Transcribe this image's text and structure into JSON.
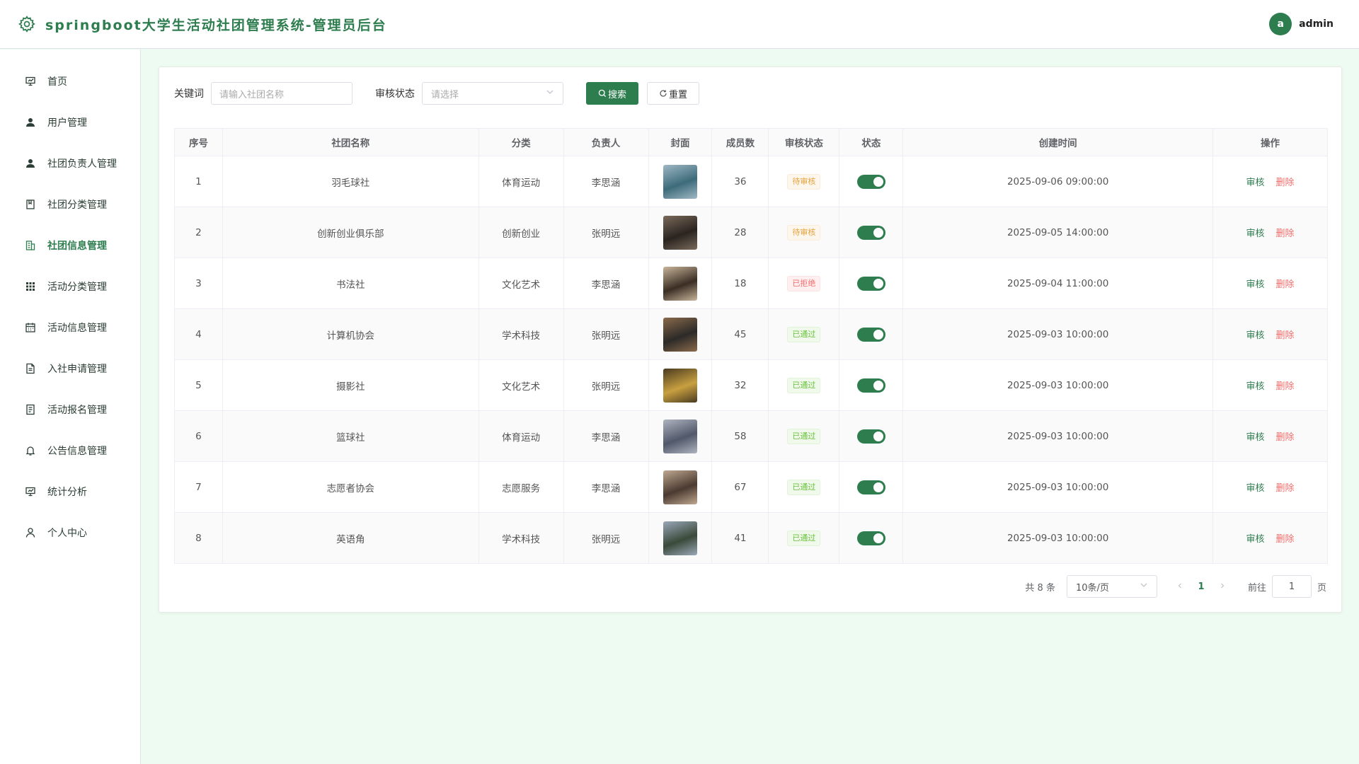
{
  "app": {
    "title": "springboot大学生活动社团管理系统-管理员后台"
  },
  "user": {
    "avatar_letter": "a",
    "name": "admin"
  },
  "colors": {
    "primary": "#2e7d4f",
    "danger": "#f56c6c",
    "warning": "#e6a23c",
    "success": "#67c23a"
  },
  "sidebar": {
    "items": [
      {
        "label": "首页",
        "icon": "presentation-icon",
        "active": false
      },
      {
        "label": "用户管理",
        "icon": "user-icon",
        "active": false
      },
      {
        "label": "社团负责人管理",
        "icon": "user-icon",
        "active": false
      },
      {
        "label": "社团分类管理",
        "icon": "bookmark-icon",
        "active": false
      },
      {
        "label": "社团信息管理",
        "icon": "building-icon",
        "active": true
      },
      {
        "label": "活动分类管理",
        "icon": "grid-icon",
        "active": false
      },
      {
        "label": "活动信息管理",
        "icon": "calendar-icon",
        "active": false
      },
      {
        "label": "入社申请管理",
        "icon": "document-icon",
        "active": false
      },
      {
        "label": "活动报名管理",
        "icon": "list-icon",
        "active": false
      },
      {
        "label": "公告信息管理",
        "icon": "bell-icon",
        "active": false
      },
      {
        "label": "统计分析",
        "icon": "chart-icon",
        "active": false
      },
      {
        "label": "个人中心",
        "icon": "person-icon",
        "active": false
      }
    ]
  },
  "filters": {
    "keyword_label": "关键词",
    "keyword_placeholder": "请输入社团名称",
    "status_label": "审核状态",
    "status_placeholder": "请选择",
    "search_label": "搜索",
    "reset_label": "重置"
  },
  "table": {
    "headers": [
      "序号",
      "社团名称",
      "分类",
      "负责人",
      "封面",
      "成员数",
      "审核状态",
      "状态",
      "创建时间",
      "操作"
    ],
    "audit_label": "审核",
    "delete_label": "删除",
    "rows": [
      {
        "idx": "1",
        "name": "羽毛球社",
        "category": "体育运动",
        "leader": "李思涵",
        "members": "36",
        "audit": "待审核",
        "audit_type": "pending",
        "enabled": true,
        "created": "2025-09-06 09:00:00",
        "cover": [
          "#3d6b7a",
          "#9fb8c4"
        ]
      },
      {
        "idx": "2",
        "name": "创新创业俱乐部",
        "category": "创新创业",
        "leader": "张明远",
        "members": "28",
        "audit": "待审核",
        "audit_type": "pending",
        "enabled": true,
        "created": "2025-09-05 14:00:00",
        "cover": [
          "#2a2420",
          "#7a6a5a"
        ]
      },
      {
        "idx": "3",
        "name": "书法社",
        "category": "文化艺术",
        "leader": "李思涵",
        "members": "18",
        "audit": "已拒绝",
        "audit_type": "rejected",
        "enabled": true,
        "created": "2025-09-04 11:00:00",
        "cover": [
          "#3a2e24",
          "#c8b49a"
        ]
      },
      {
        "idx": "4",
        "name": "计算机协会",
        "category": "学术科技",
        "leader": "张明远",
        "members": "45",
        "audit": "已通过",
        "audit_type": "passed",
        "enabled": true,
        "created": "2025-09-03 10:00:00",
        "cover": [
          "#2c2a28",
          "#8a6a4a"
        ]
      },
      {
        "idx": "5",
        "name": "摄影社",
        "category": "文化艺术",
        "leader": "张明远",
        "members": "32",
        "audit": "已通过",
        "audit_type": "passed",
        "enabled": true,
        "created": "2025-09-03 10:00:00",
        "cover": [
          "#c8a040",
          "#4a3a20"
        ]
      },
      {
        "idx": "6",
        "name": "篮球社",
        "category": "体育运动",
        "leader": "李思涵",
        "members": "58",
        "audit": "已通过",
        "audit_type": "passed",
        "enabled": true,
        "created": "2025-09-03 10:00:00",
        "cover": [
          "#50586a",
          "#b0b4c0"
        ]
      },
      {
        "idx": "7",
        "name": "志愿者协会",
        "category": "志愿服务",
        "leader": "李思涵",
        "members": "67",
        "audit": "已通过",
        "audit_type": "passed",
        "enabled": true,
        "created": "2025-09-03 10:00:00",
        "cover": [
          "#4a3a30",
          "#c0a890"
        ]
      },
      {
        "idx": "8",
        "name": "英语角",
        "category": "学术科技",
        "leader": "张明远",
        "members": "41",
        "audit": "已通过",
        "audit_type": "passed",
        "enabled": true,
        "created": "2025-09-03 10:00:00",
        "cover": [
          "#3a4a3a",
          "#9aa8b8"
        ]
      }
    ]
  },
  "pagination": {
    "total_text": "共 8 条",
    "page_size": "10条/页",
    "current_page": "1",
    "goto_label": "前往",
    "goto_value": "1",
    "page_suffix": "页"
  }
}
